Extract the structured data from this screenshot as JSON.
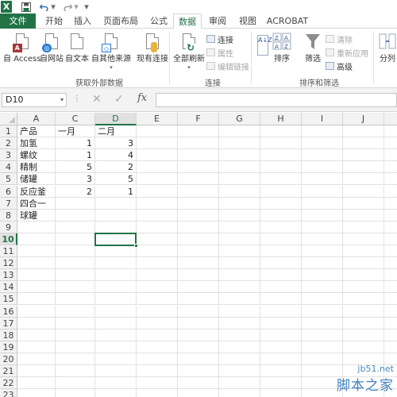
{
  "qat": {
    "logo": "X",
    "save_icon": "save-icon",
    "undo_icon": "undo-icon",
    "redo_icon": "redo-icon"
  },
  "tabs": [
    "文件",
    "开始",
    "插入",
    "页面布局",
    "公式",
    "数据",
    "审阅",
    "视图",
    "ACROBAT"
  ],
  "ribbon": {
    "get_external": {
      "buttons": [
        "自 Access",
        "自网站",
        "自文本",
        "自其他来源",
        "现有连接"
      ],
      "label": "获取外部数据"
    },
    "connections": {
      "refresh_all": "全部刷新",
      "items": [
        "连接",
        "属性",
        "编辑链接"
      ],
      "label": "连接"
    },
    "sort_filter": {
      "sort_az": "A↓Z",
      "sort": "排序",
      "filter": "筛选",
      "items": [
        "清除",
        "重新应用",
        "高级"
      ],
      "label": "排序和筛选"
    },
    "columns": "分列"
  },
  "formula_bar": {
    "name_box": "D10",
    "fx": "fx",
    "value": ""
  },
  "columns": [
    {
      "name": "A",
      "width": 48
    },
    {
      "name": "C",
      "width": 50
    },
    {
      "name": "D",
      "width": 52
    },
    {
      "name": "E",
      "width": 52
    },
    {
      "name": "F",
      "width": 52
    },
    {
      "name": "G",
      "width": 52
    },
    {
      "name": "H",
      "width": 52
    },
    {
      "name": "I",
      "width": 52
    },
    {
      "name": "J",
      "width": 52
    },
    {
      "name": "",
      "width": 20
    }
  ],
  "selected_column": "D",
  "selected_row": 10,
  "rows": [
    {
      "n": 1,
      "cells": [
        "产品",
        "一月",
        "二月"
      ]
    },
    {
      "n": 2,
      "cells": [
        "加氢",
        "1",
        "3"
      ]
    },
    {
      "n": 3,
      "cells": [
        "螺纹",
        "1",
        "4"
      ]
    },
    {
      "n": 4,
      "cells": [
        "精制",
        "5",
        "2"
      ]
    },
    {
      "n": 5,
      "cells": [
        "储罐",
        "3",
        "5"
      ]
    },
    {
      "n": 6,
      "cells": [
        "反应釜",
        "2",
        "1"
      ]
    },
    {
      "n": 7,
      "cells": [
        "四合一",
        "",
        ""
      ]
    },
    {
      "n": 8,
      "cells": [
        "球罐",
        "",
        ""
      ]
    },
    {
      "n": 9,
      "cells": [
        "",
        "",
        ""
      ]
    },
    {
      "n": 10,
      "cells": [
        "",
        "",
        ""
      ]
    },
    {
      "n": 11,
      "cells": [
        "",
        "",
        ""
      ]
    },
    {
      "n": 12,
      "cells": [
        "",
        "",
        ""
      ]
    },
    {
      "n": 13,
      "cells": [
        "",
        "",
        ""
      ]
    },
    {
      "n": 14,
      "cells": [
        "",
        "",
        ""
      ]
    },
    {
      "n": 15,
      "cells": [
        "",
        "",
        ""
      ]
    },
    {
      "n": 16,
      "cells": [
        "",
        "",
        ""
      ]
    },
    {
      "n": 17,
      "cells": [
        "",
        "",
        ""
      ]
    },
    {
      "n": 18,
      "cells": [
        "",
        "",
        ""
      ]
    },
    {
      "n": 19,
      "cells": [
        "",
        "",
        ""
      ]
    },
    {
      "n": 20,
      "cells": [
        "",
        "",
        ""
      ]
    },
    {
      "n": 21,
      "cells": [
        "",
        "",
        ""
      ]
    },
    {
      "n": 22,
      "cells": [
        "",
        "",
        ""
      ]
    },
    {
      "n": 23,
      "cells": [
        "",
        "",
        ""
      ]
    }
  ],
  "watermark": {
    "url": "jb51.net",
    "name": "脚本之家"
  }
}
